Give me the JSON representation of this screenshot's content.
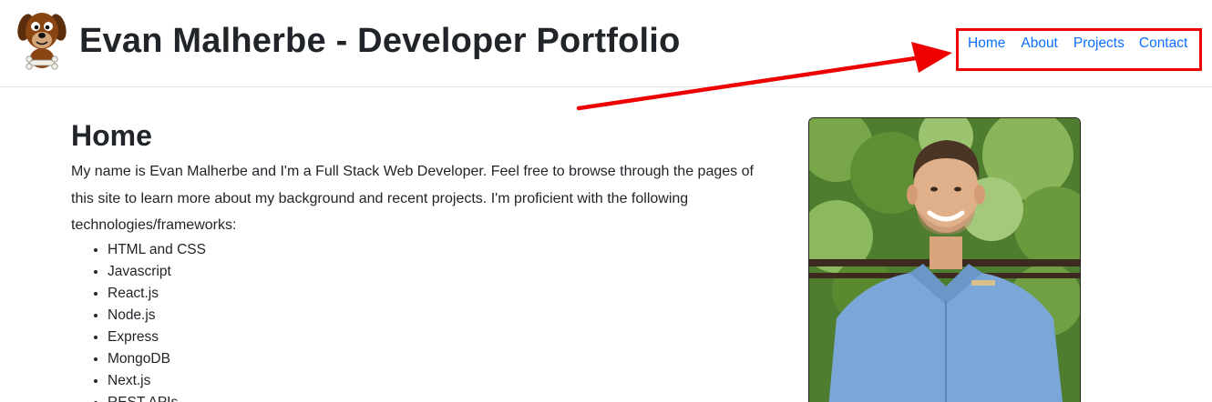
{
  "header": {
    "title": "Evan Malherbe - Developer Portfolio",
    "logo_icon": "cartoon-dog-icon"
  },
  "nav": {
    "items": [
      {
        "label": "Home"
      },
      {
        "label": "About"
      },
      {
        "label": "Projects"
      },
      {
        "label": "Contact"
      }
    ],
    "link_color": "#0d6efd",
    "highlight_color": "#ee0000"
  },
  "main": {
    "heading": "Home",
    "intro": "My name is Evan Malherbe and I'm a Full Stack Web Developer. Feel free to browse through the pages of this site to learn more about my background and recent projects. I'm proficient with the following technologies/frameworks:",
    "technologies": [
      "HTML and CSS",
      "Javascript",
      "React.js",
      "Node.js",
      "Express",
      "MongoDB",
      "Next.js",
      "REST APIs"
    ]
  },
  "photo": {
    "icon": "profile-photo"
  }
}
